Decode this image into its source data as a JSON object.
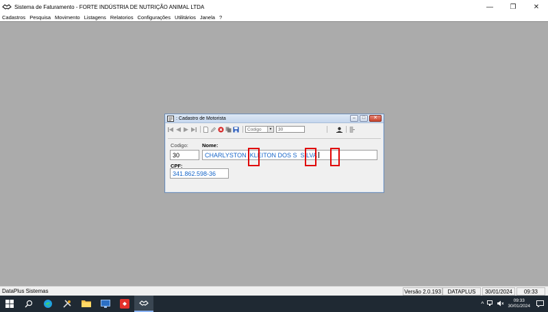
{
  "window": {
    "title": "Sistema de Faturamento - FORTE INDÚSTRIA DE NUTRIÇÃO ANIMAL LTDA",
    "minimize": "—",
    "restore": "❐",
    "close": "✕"
  },
  "menu": [
    "Cadastros",
    "Pesquisa",
    "Movimento",
    "Listagens",
    "Relatorios",
    "Configurações",
    "Utilitários",
    "Janela",
    "?"
  ],
  "child": {
    "title": ": Cadastro de Motorista",
    "search_field": "Codigo",
    "search_value": "30",
    "codigo_label": "Codigo:",
    "codigo_value": "30",
    "nome_label": "Nome:",
    "nome_value": "CHARLYSTON  KLEITON DOS S  SILVA",
    "cpf_label": "CPF:",
    "cpf_value": "341.862.598-36"
  },
  "status": {
    "left": "DataPlus Sistemas",
    "version": "Versão 2.0.193",
    "company": "DATAPLUS",
    "date": "30/01/2024",
    "time": "09:33"
  },
  "taskbar": {
    "clock_time": "09:33",
    "clock_date": "30/01/2024",
    "tray_arrow": "^"
  },
  "colors": {
    "field_text": "#1464c8",
    "highlight": "#e00000",
    "taskbar": "#1f2933"
  }
}
